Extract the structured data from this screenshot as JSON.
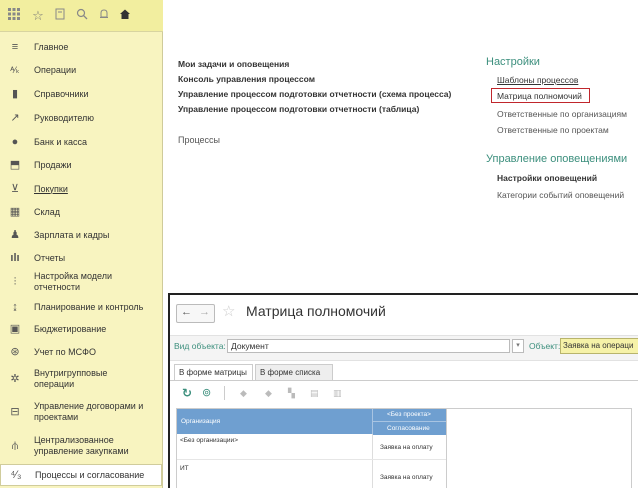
{
  "toolbar": {
    "icons": [
      "grid-icon",
      "star-icon",
      "history-icon",
      "search-icon",
      "bell-icon",
      "home-icon"
    ]
  },
  "sidebar": {
    "items": [
      {
        "label": "Главное",
        "icon": "menu-icon"
      },
      {
        "label": "Операции",
        "icon": "operations-icon"
      },
      {
        "label": "Справочники",
        "icon": "book-icon"
      },
      {
        "label": "Руководителю",
        "icon": "trend-icon"
      },
      {
        "label": "Банк и касса",
        "icon": "bank-icon"
      },
      {
        "label": "Продажи",
        "icon": "bag-icon"
      },
      {
        "label": "Покупки",
        "icon": "cart-icon"
      },
      {
        "label": "Склад",
        "icon": "warehouse-icon"
      },
      {
        "label": "Зарплата и кадры",
        "icon": "person-icon"
      },
      {
        "label": "Отчеты",
        "icon": "reports-icon"
      },
      {
        "label": "Настройка модели\nотчетности",
        "icon": "model-icon"
      },
      {
        "label": "Планирование и контроль",
        "icon": "planning-icon"
      },
      {
        "label": "Бюджетирование",
        "icon": "budget-icon"
      },
      {
        "label": "Учет по МСФО",
        "icon": "globe-icon"
      },
      {
        "label": "Внутригрупповые\nоперации",
        "icon": "group-icon"
      },
      {
        "label": "Управление договорами и\nпроектами",
        "icon": "contract-icon"
      },
      {
        "label": "Централизованное\nуправление закупками",
        "icon": "procurement-icon"
      },
      {
        "label": "Процессы и согласование",
        "icon": "process-icon"
      }
    ]
  },
  "main": {
    "left_links": [
      "Мои задачи и оповещения",
      "Консоль управления процессом",
      "Управление процессом подготовки отчетности (схема процесса)",
      "Управление процессом подготовки отчетности (таблица)"
    ],
    "processes_label": "Процессы",
    "settings_title": "Настройки",
    "settings_links": [
      "Шаблоны процессов",
      "Матрица полномочий",
      "Ответственные по организациям",
      "Ответственные по проектам"
    ],
    "notify_title": "Управление оповещениями",
    "notify_links": [
      "Настройки оповещений",
      "Категории событий оповещений"
    ]
  },
  "window": {
    "title": "Матрица полномочий",
    "object_type_label": "Вид объекта:",
    "object_type_value": "Документ",
    "object_label": "Объект:",
    "object_value": "Заявка на операци",
    "tabs": [
      "В форме матрицы",
      "В форме списка"
    ],
    "grid": {
      "col_org": "Организация",
      "col_project": "<Без проекта>",
      "col_approval": "Согласование",
      "rows": [
        {
          "org": "<Без организации>",
          "value": "Заявка на оплату"
        },
        {
          "org": "ИТ",
          "value": "Заявка на оплату"
        }
      ]
    }
  },
  "colors": {
    "sidebar_bg": "#f8f4c0",
    "accent_green": "#3c8f7d",
    "highlight_border": "#c0262c",
    "grid_header": "#6f9fd0"
  }
}
